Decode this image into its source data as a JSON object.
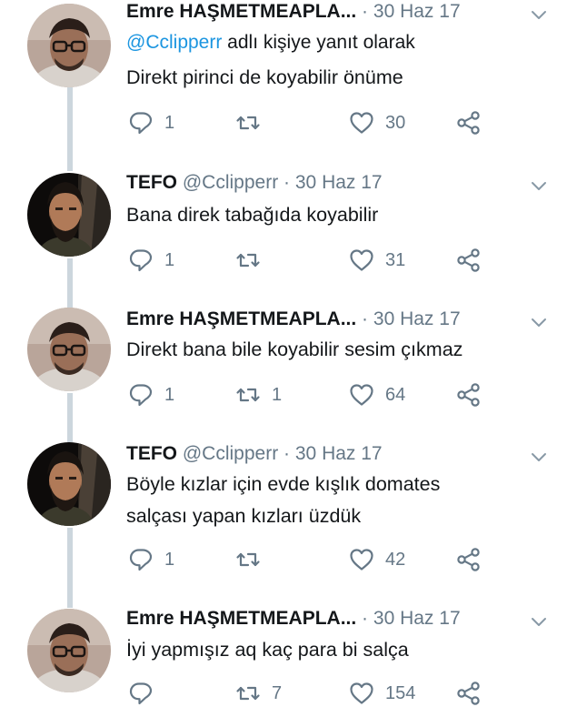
{
  "tweets": [
    {
      "name": "Emre HAŞMETMEAPLA...",
      "handle": "",
      "separator": "·",
      "date": "30 Haz 17",
      "avatar": "man-with-glasses",
      "reply_prefix": "@Cclipperr",
      "reply_suffix": " adlı kişiye yanıt olarak",
      "text": "Direkt pirinci de koyabilir önüme",
      "counts": {
        "reply": "1",
        "retweet": "",
        "like": "30"
      }
    },
    {
      "name": "TEFO",
      "handle": "@Cclipperr",
      "separator": "·",
      "date": "30 Haz 17",
      "avatar": "bearded-man",
      "text": "Bana direk tabağıda koyabilir",
      "counts": {
        "reply": "1",
        "retweet": "",
        "like": "31"
      }
    },
    {
      "name": "Emre HAŞMETMEAPLA...",
      "handle": "",
      "separator": "·",
      "date": "30 Haz 17",
      "avatar": "man-with-glasses",
      "text": "Direkt bana bile koyabilir sesim çıkmaz",
      "counts": {
        "reply": "1",
        "retweet": "1",
        "like": "64"
      }
    },
    {
      "name": "TEFO",
      "handle": "@Cclipperr",
      "separator": "·",
      "date": "30 Haz 17",
      "avatar": "bearded-man",
      "text_line1": "Böyle kızlar için evde kışlık domates",
      "text_line2": "salçası yapan kızları üzdük",
      "counts": {
        "reply": "1",
        "retweet": "",
        "like": "42"
      }
    },
    {
      "name": "Emre HAŞMETMEAPLA...",
      "handle": "",
      "separator": "·",
      "date": "30 Haz 17",
      "avatar": "man-with-glasses",
      "text": "İyi yapmışız aq kaç para bi salça",
      "counts": {
        "reply": "",
        "retweet": "7",
        "like": "154"
      }
    }
  ],
  "icons": {
    "reply": "reply-icon",
    "retweet": "retweet-icon",
    "like": "heart-icon",
    "share": "share-icon",
    "menu": "chevron-down-icon"
  },
  "colors": {
    "text": "#14171a",
    "secondary": "#657786",
    "link": "#1b95e0",
    "thread_line": "#ccd6dd"
  }
}
